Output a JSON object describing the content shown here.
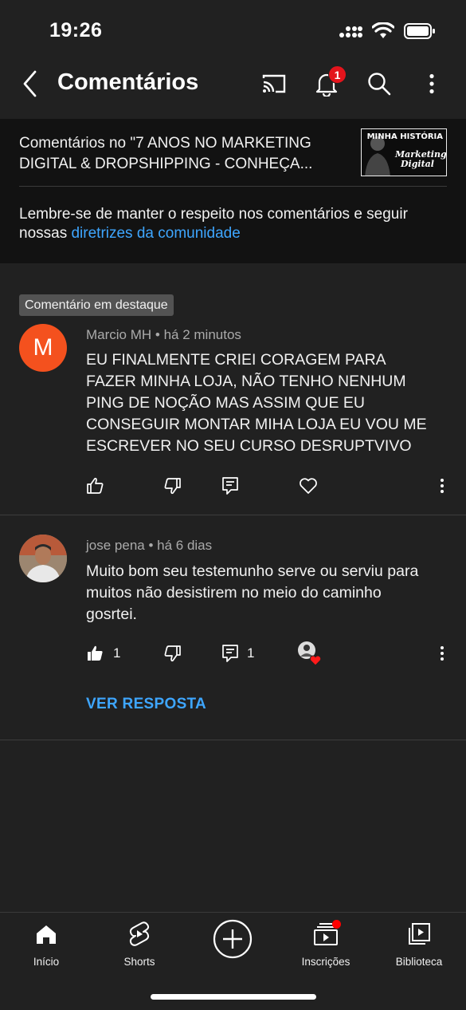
{
  "status": {
    "time": "19:26"
  },
  "app_bar": {
    "title": "Comentários",
    "notification_count": "1"
  },
  "video": {
    "title": "Comentários no \"7 ANOS NO MARKETING DIGITAL & DROPSHIPPING - CONHEÇA...",
    "thumbnail_text_1": "MINHA HISTÓRIA",
    "thumbnail_text_2": "Marketing Digital"
  },
  "guidelines": {
    "text": "Lembre-se de manter o respeito nos comentários e seguir nossas ",
    "link": "diretrizes da comunidade"
  },
  "featured_label": "Comentário em destaque",
  "comments": [
    {
      "author": "Marcio MH",
      "avatar_letter": "M",
      "time": "há 2 minutos",
      "text": "EU FINALMENTE CRIEI CORAGEM PARA FAZER MINHA LOJA, NÃO TENHO NENHUM PING DE NOÇÃO MAS ASSIM QUE EU CONSEGUIR MONTAR MIHA LOJA EU VOU ME ESCREVER NO SEU CURSO DESRUPTVIVO"
    },
    {
      "author": "jose pena",
      "time": "há 6 dias",
      "text": "Muito bom seu testemunho serve ou serviu para muitos não desistirem no meio do caminho gosrtei.",
      "likes": "1",
      "replies": "1",
      "view_replies_label": "VER RESPOSTA"
    }
  ],
  "nav": [
    {
      "label": "Início",
      "icon": "home-icon"
    },
    {
      "label": "Shorts",
      "icon": "shorts-icon"
    },
    {
      "label": "",
      "icon": "create-icon"
    },
    {
      "label": "Inscrições",
      "icon": "subscriptions-icon"
    },
    {
      "label": "Biblioteca",
      "icon": "library-icon"
    }
  ],
  "colors": {
    "background": "#212121",
    "header_panel": "#121212",
    "accent_link": "#3ea6ff",
    "badge": "#e4141c",
    "avatar_m": "#f4511e"
  }
}
